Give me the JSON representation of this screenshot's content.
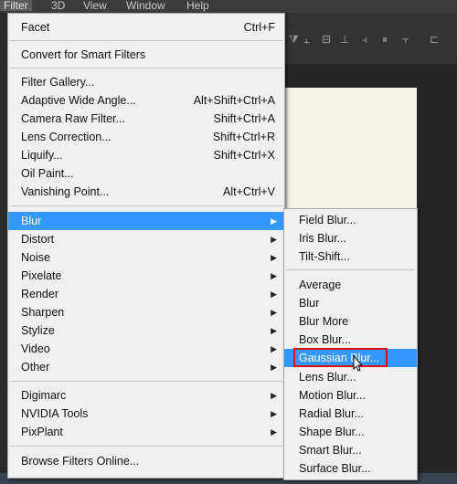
{
  "menubar": {
    "items": [
      {
        "label": "Filter",
        "active": true
      },
      {
        "label": "3D"
      },
      {
        "label": "View"
      },
      {
        "label": "Window"
      },
      {
        "label": "Help"
      }
    ]
  },
  "filter_menu": {
    "facet": {
      "label": "Facet",
      "shortcut": "Ctrl+F"
    },
    "convert": {
      "label": "Convert for Smart Filters"
    },
    "group2": [
      {
        "label": "Filter Gallery...",
        "shortcut": ""
      },
      {
        "label": "Adaptive Wide Angle...",
        "shortcut": "Alt+Shift+Ctrl+A"
      },
      {
        "label": "Camera Raw Filter...",
        "shortcut": "Shift+Ctrl+A"
      },
      {
        "label": "Lens Correction...",
        "shortcut": "Shift+Ctrl+R"
      },
      {
        "label": "Liquify...",
        "shortcut": "Shift+Ctrl+X"
      },
      {
        "label": "Oil Paint...",
        "shortcut": ""
      },
      {
        "label": "Vanishing Point...",
        "shortcut": "Alt+Ctrl+V"
      }
    ],
    "group3": [
      {
        "label": "Blur",
        "highlight": true
      },
      {
        "label": "Distort"
      },
      {
        "label": "Noise"
      },
      {
        "label": "Pixelate"
      },
      {
        "label": "Render"
      },
      {
        "label": "Sharpen"
      },
      {
        "label": "Stylize"
      },
      {
        "label": "Video"
      },
      {
        "label": "Other"
      }
    ],
    "group4": [
      {
        "label": "Digimarc"
      },
      {
        "label": "NVIDIA Tools"
      },
      {
        "label": "PixPlant"
      }
    ],
    "browse": {
      "label": "Browse Filters Online..."
    }
  },
  "blur_submenu": {
    "group1": [
      {
        "label": "Field Blur..."
      },
      {
        "label": "Iris Blur..."
      },
      {
        "label": "Tilt-Shift..."
      }
    ],
    "group2": [
      {
        "label": "Average"
      },
      {
        "label": "Blur"
      },
      {
        "label": "Blur More"
      },
      {
        "label": "Box Blur..."
      },
      {
        "label": "Gaussian Blur...",
        "highlight": true
      },
      {
        "label": "Lens Blur..."
      },
      {
        "label": "Motion Blur..."
      },
      {
        "label": "Radial Blur..."
      },
      {
        "label": "Shape Blur..."
      },
      {
        "label": "Smart Blur..."
      },
      {
        "label": "Surface Blur..."
      }
    ]
  },
  "colors": {
    "highlight": "#3399ff",
    "annotation": "#e01010"
  }
}
